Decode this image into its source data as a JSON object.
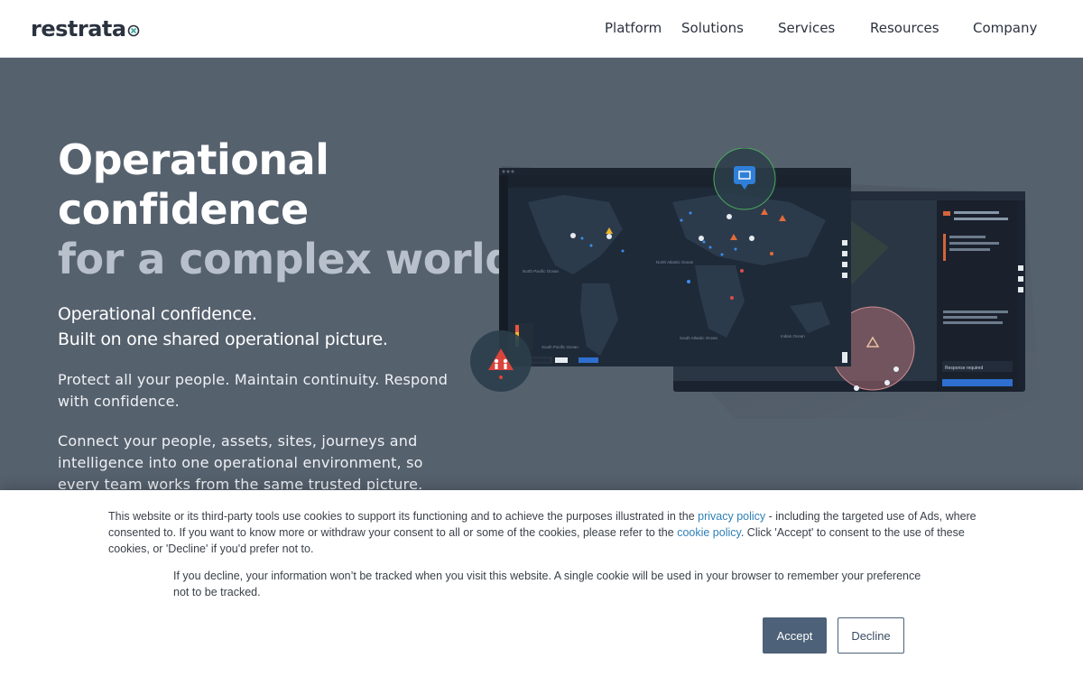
{
  "header": {
    "logo_text": "restrata",
    "nav": [
      {
        "label": "Platform"
      },
      {
        "label": "Solutions"
      },
      {
        "label": "Services"
      },
      {
        "label": "Resources"
      },
      {
        "label": "Company"
      }
    ]
  },
  "hero": {
    "title_line1": "Operational",
    "title_line2": "confidence",
    "title_line3": "for a complex world",
    "subtitle_line1": "Operational confidence.",
    "subtitle_line2": "Built on one shared operational picture.",
    "paragraph1": "Protect all your people. Maintain continuity. Respond with confidence.",
    "paragraph2": "Connect your people, assets, sites, journeys and intelligence into one operational environment, so every team works from the same trusted picture."
  },
  "screens": {
    "response_label": "Response required",
    "map_labels": [
      "North Pacific Ocean",
      "North Atlantic Ocean",
      "South Pacific Ocean",
      "South Atlantic Ocean",
      "Indian Ocean"
    ]
  },
  "cookie": {
    "text1_a": "This website or its third-party tools use cookies to support its functioning and to achieve the purposes illustrated in the ",
    "privacy_link": "privacy policy",
    "text1_b": " - including the targeted use of Ads, where consented to. If you want to know more or withdraw your consent to all or some of the cookies, please refer to the ",
    "cookie_link": "cookie policy",
    "text1_c": ". Click 'Accept' to consent to the use of these cookies, or 'Decline' if you'd prefer not to.",
    "text2": "If you decline, your information won’t be tracked when you visit this website. A single cookie will be used in your browser to remember your preference not to be tracked.",
    "accept_label": "Accept",
    "decline_label": "Decline"
  },
  "colors": {
    "hero_bg": "#56616e",
    "title_muted": "#b8c1cb",
    "accept_bg": "#4d6178",
    "link": "#2f7fb6"
  }
}
